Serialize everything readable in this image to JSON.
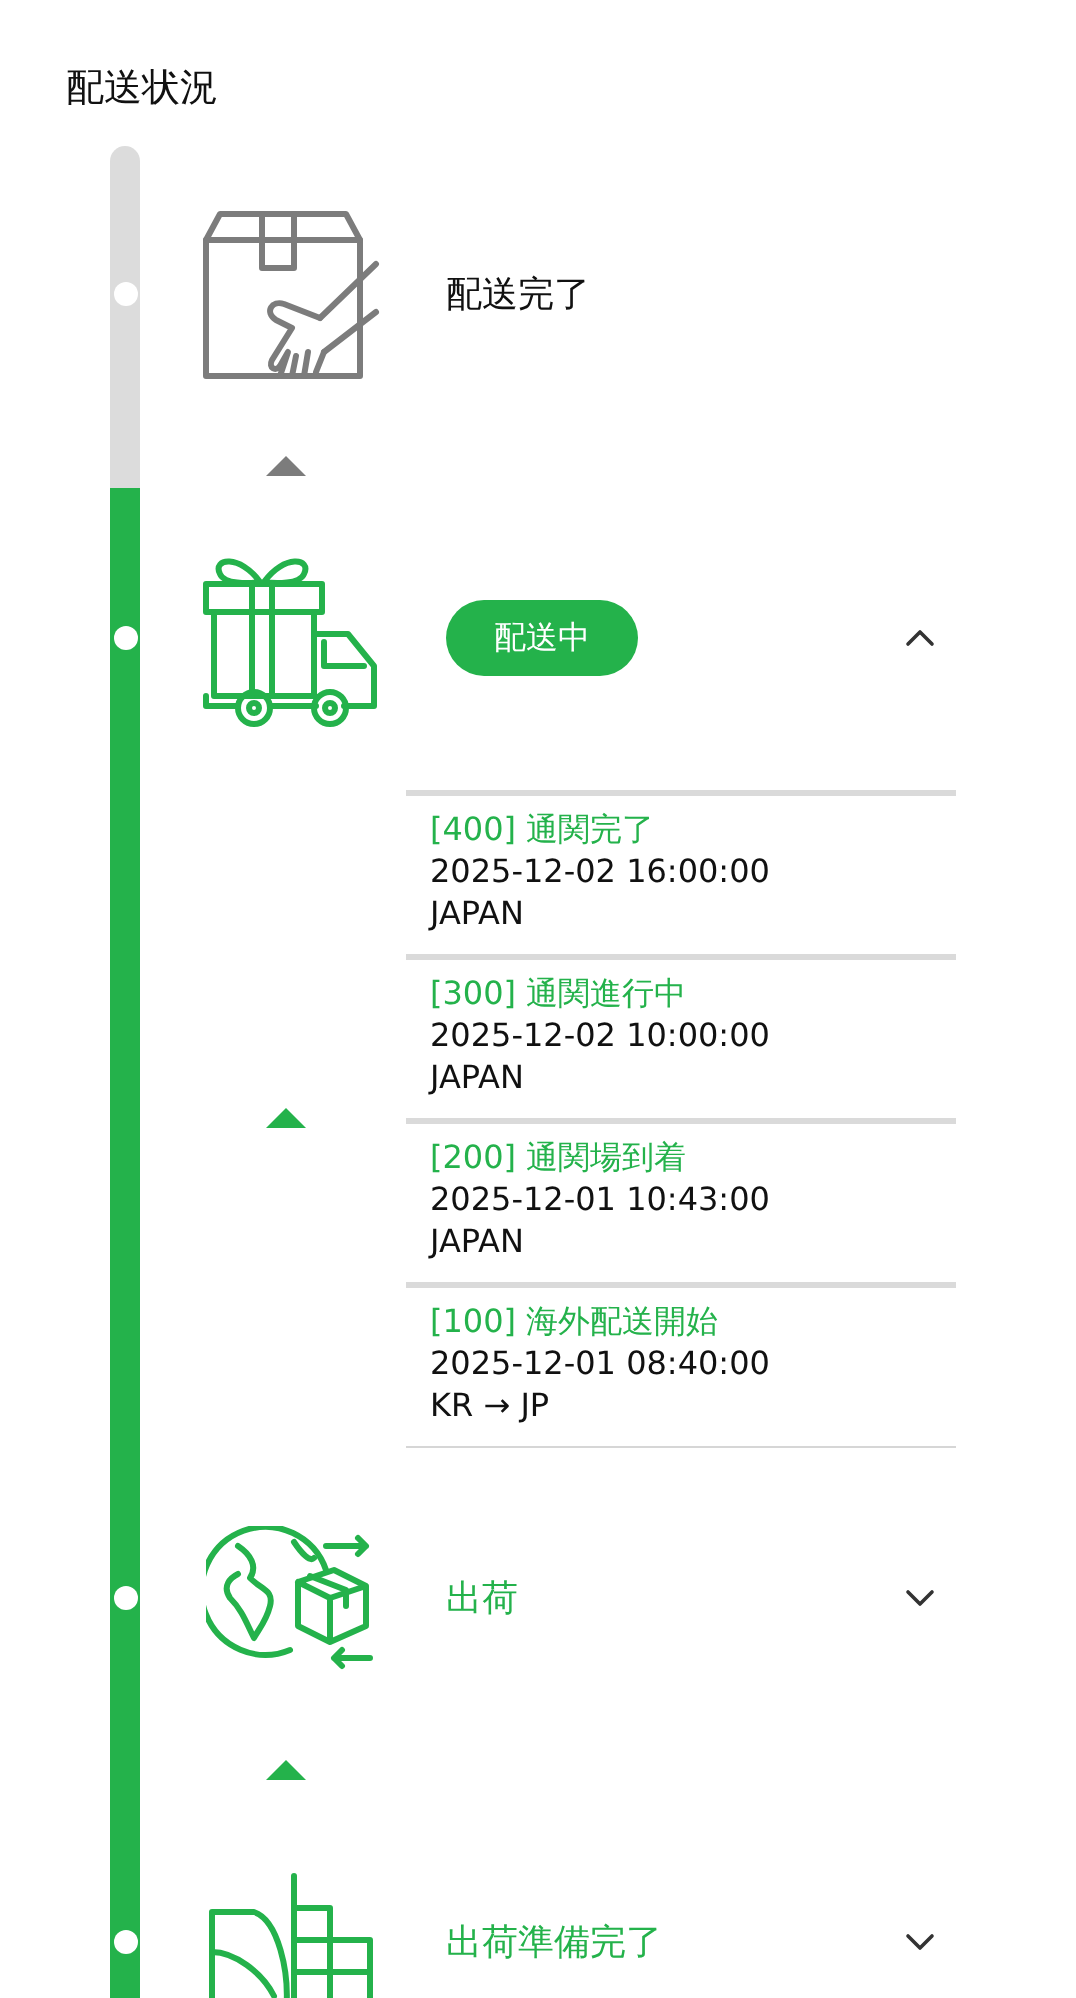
{
  "title": "配送状況",
  "steps": [
    {
      "kind": "handover",
      "label": "配送完了",
      "reached": false,
      "current": false
    },
    {
      "kind": "gift-truck",
      "label": "配送中",
      "reached": true,
      "current": true,
      "expanded": true,
      "events": [
        {
          "title": "[400] 通関完了",
          "time": "2025-12-02 16:00:00",
          "place": "JAPAN"
        },
        {
          "title": "[300] 通関進行中",
          "time": "2025-12-02 10:00:00",
          "place": "JAPAN"
        },
        {
          "title": "[200] 通関場到着",
          "time": "2025-12-01 10:43:00",
          "place": "JAPAN"
        },
        {
          "title": "[100] 海外配送開始",
          "time": "2025-12-01 08:40:00",
          "place": "KR → JP"
        }
      ]
    },
    {
      "kind": "globe-box",
      "label": "出荷",
      "reached": true,
      "current": false,
      "expanded": false
    },
    {
      "kind": "warehouse",
      "label": "出荷準備完了",
      "reached": true,
      "current": false,
      "expanded": false
    }
  ]
}
